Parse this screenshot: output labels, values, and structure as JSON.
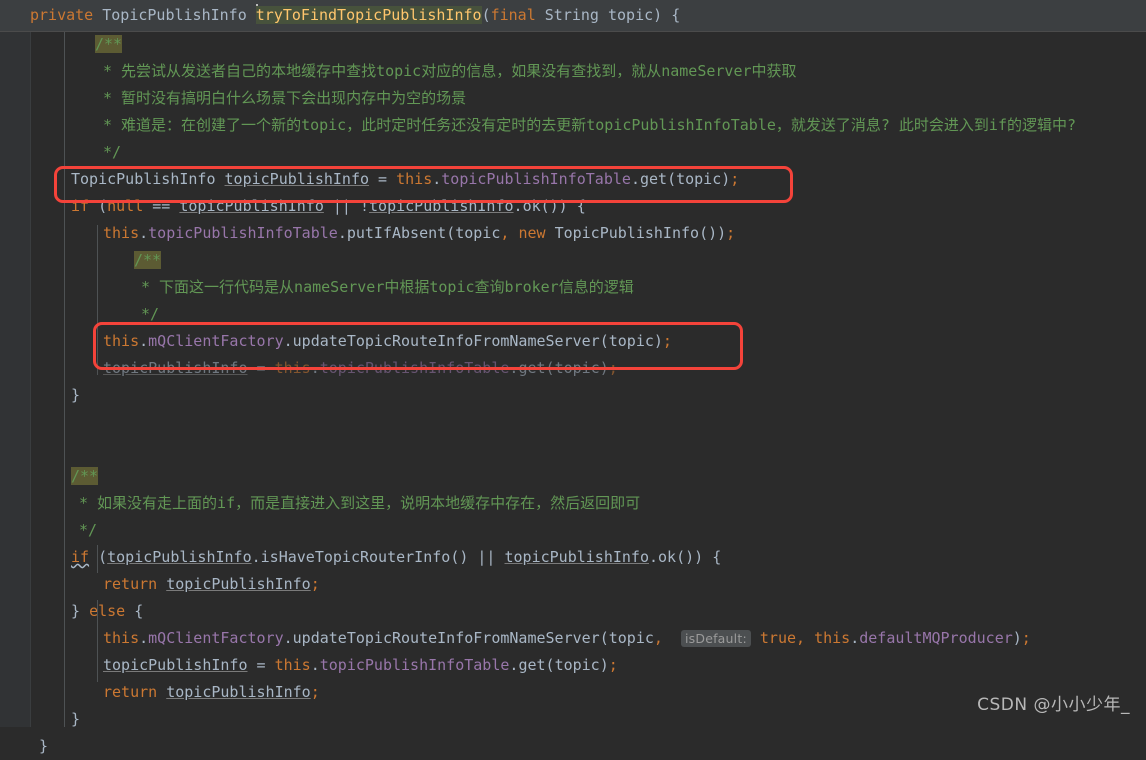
{
  "editor": {
    "language": "java",
    "theme": "darcula",
    "background_color": "#2b2b2b",
    "gutter_color": "#313335",
    "signature_bar_color": "#3c3f41"
  },
  "signature_line": {
    "modifier": "private",
    "return_type": "TopicPublishInfo",
    "method_name": "tryToFindTopicPublishInfo",
    "open_paren": "(",
    "param_modifier": "final",
    "param_type": "String",
    "param_name": "topic",
    "close_paren": ")",
    "brace": "{"
  },
  "lines": [
    {
      "id": "l1",
      "type": "comment-open",
      "text": "/**"
    },
    {
      "id": "l2",
      "type": "comment",
      "text": "* 先尝试从发送者自己的本地缓存中查找topic对应的信息，如果没有查找到，就从nameServer中获取"
    },
    {
      "id": "l3",
      "type": "comment",
      "text": "* 暂时没有搞明白什么场景下会出现内存中为空的场景"
    },
    {
      "id": "l4",
      "type": "comment",
      "text": "* 难道是：在创建了一个新的topic，此时定时任务还没有定时的去更新topicPublishInfoTable，就发送了消息? 此时会进入到if的逻辑中?"
    },
    {
      "id": "l5",
      "type": "comment-close",
      "text": "*/"
    },
    {
      "id": "l6",
      "type": "code",
      "text": "TopicPublishInfo topicPublishInfo = this.topicPublishInfoTable.get(topic);"
    },
    {
      "id": "l7",
      "type": "code",
      "text": "if (null == topicPublishInfo || !topicPublishInfo.ok()) {"
    },
    {
      "id": "l8",
      "type": "code",
      "text": "this.topicPublishInfoTable.putIfAbsent(topic, new TopicPublishInfo());"
    },
    {
      "id": "l9",
      "type": "comment-open",
      "text": "/**"
    },
    {
      "id": "l10",
      "type": "comment",
      "text": "* 下面这一行代码是从nameServer中根据topic查询broker信息的逻辑"
    },
    {
      "id": "l11",
      "type": "comment-close",
      "text": "*/"
    },
    {
      "id": "l12",
      "type": "code",
      "text": "this.mQClientFactory.updateTopicRouteInfoFromNameServer(topic);"
    },
    {
      "id": "l13",
      "type": "code",
      "text": "topicPublishInfo = this.topicPublishInfoTable.get(topic);"
    },
    {
      "id": "l14",
      "type": "code",
      "text": "}"
    },
    {
      "id": "l15",
      "type": "blank",
      "text": ""
    },
    {
      "id": "l16",
      "type": "blank",
      "text": ""
    },
    {
      "id": "l17",
      "type": "comment-open",
      "text": "/**"
    },
    {
      "id": "l18",
      "type": "comment",
      "text": "* 如果没有走上面的if，而是直接进入到这里，说明本地缓存中存在，然后返回即可"
    },
    {
      "id": "l19",
      "type": "comment-close",
      "text": "*/"
    },
    {
      "id": "l20",
      "type": "code",
      "text": "if (topicPublishInfo.isHaveTopicRouterInfo() || topicPublishInfo.ok()) {"
    },
    {
      "id": "l21",
      "type": "code",
      "text": "return topicPublishInfo;"
    },
    {
      "id": "l22",
      "type": "code",
      "text": "} else {"
    },
    {
      "id": "l23",
      "type": "code",
      "text": "this.mQClientFactory.updateTopicRouteInfoFromNameServer(topic, isDefault: true, this.defaultMQProducer);"
    },
    {
      "id": "l24",
      "type": "code",
      "text": "topicPublishInfo = this.topicPublishInfoTable.get(topic);"
    },
    {
      "id": "l25",
      "type": "code",
      "text": "return topicPublishInfo;"
    },
    {
      "id": "l26",
      "type": "code",
      "text": "}"
    },
    {
      "id": "l27",
      "type": "code",
      "text": "}"
    }
  ],
  "tokens": {
    "kw_private": "private",
    "kw_final": "final",
    "kw_new": "new",
    "kw_null": "null",
    "kw_if": "if",
    "kw_else": "else",
    "kw_return": "return",
    "kw_this": "this",
    "kw_true": "true",
    "type_String": "String",
    "type_TopicPublishInfo": "TopicPublishInfo",
    "var_topic": "topic",
    "var_topicPublishInfo": "topicPublishInfo",
    "field_topicPublishInfoTable": "topicPublishInfoTable",
    "field_mQClientFactory": "mQClientFactory",
    "field_defaultMQProducer": "defaultMQProducer",
    "m_get": "get",
    "m_ok": "ok",
    "m_putIfAbsent": "putIfAbsent",
    "m_updateTopicRouteInfoFromNameServer": "updateTopicRouteInfoFromNameServer",
    "m_isHaveTopicRouterInfo": "isHaveTopicRouterInfo",
    "param_hint_isDefault": "isDefault:"
  },
  "annotations": {
    "highlight_color": "#f4433a",
    "boxes": [
      {
        "name": "highlight-box-get-from-cache",
        "label": "TopicPublishInfo topicPublishInfo = this.topicPublishInfoTable.get(topic);"
      },
      {
        "name": "highlight-box-update-route",
        "label": "this.mQClientFactory.updateTopicRouteInfoFromNameServer(topic);"
      }
    ]
  },
  "watermark": {
    "text": "CSDN @小小少年_"
  }
}
